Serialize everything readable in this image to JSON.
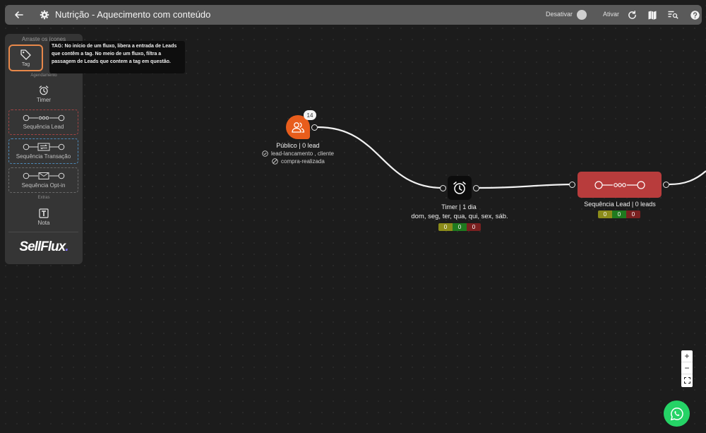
{
  "header": {
    "title": "Nutrição - Aquecimento com conteúdo",
    "deactivate_label": "Desativar",
    "activate_label": "Ativar"
  },
  "sidebar": {
    "heading": "Arraste os ícones",
    "sections": {
      "scheduling": "Agendamento",
      "extras": "Extras"
    },
    "tools": {
      "tag": "Tag",
      "timer": "Timer",
      "seq_lead": "Sequência Lead",
      "seq_transaction": "Sequência Transação",
      "seq_optin": "Sequência Opt-in",
      "note": "Nota"
    },
    "logo": "SellFlux",
    "logo_dot": "."
  },
  "tooltip": {
    "text": "TAG: No início de um fluxo, libera a entrada de Leads que contêm a tag. No meio de um fluxo, filtra a passagem de Leads que contem a tag em questão."
  },
  "nodes": {
    "public": {
      "badge": "14",
      "label": "Público | 0 lead",
      "include_tags": "lead-lancamento , cliente",
      "exclude_tags": "compra-realizada"
    },
    "timer": {
      "label": "Timer | 1 dia",
      "days": "dom, seg, ter, qua, qui, sex, sáb.",
      "counters": [
        "0",
        "0",
        "0"
      ]
    },
    "sequence": {
      "label": "Sequência Lead | 0 leads",
      "counters": [
        "0",
        "0",
        "0"
      ]
    }
  },
  "zoom": {
    "plus": "+",
    "minus": "−"
  },
  "colors": {
    "public": "#e85d1c",
    "sequence": "#b83c3c",
    "tag_highlight": "#e8884a",
    "counter_yellow": "#8c8c1a",
    "counter_green": "#1f7a1f",
    "counter_red": "#7a2020",
    "whatsapp": "#25d366"
  }
}
